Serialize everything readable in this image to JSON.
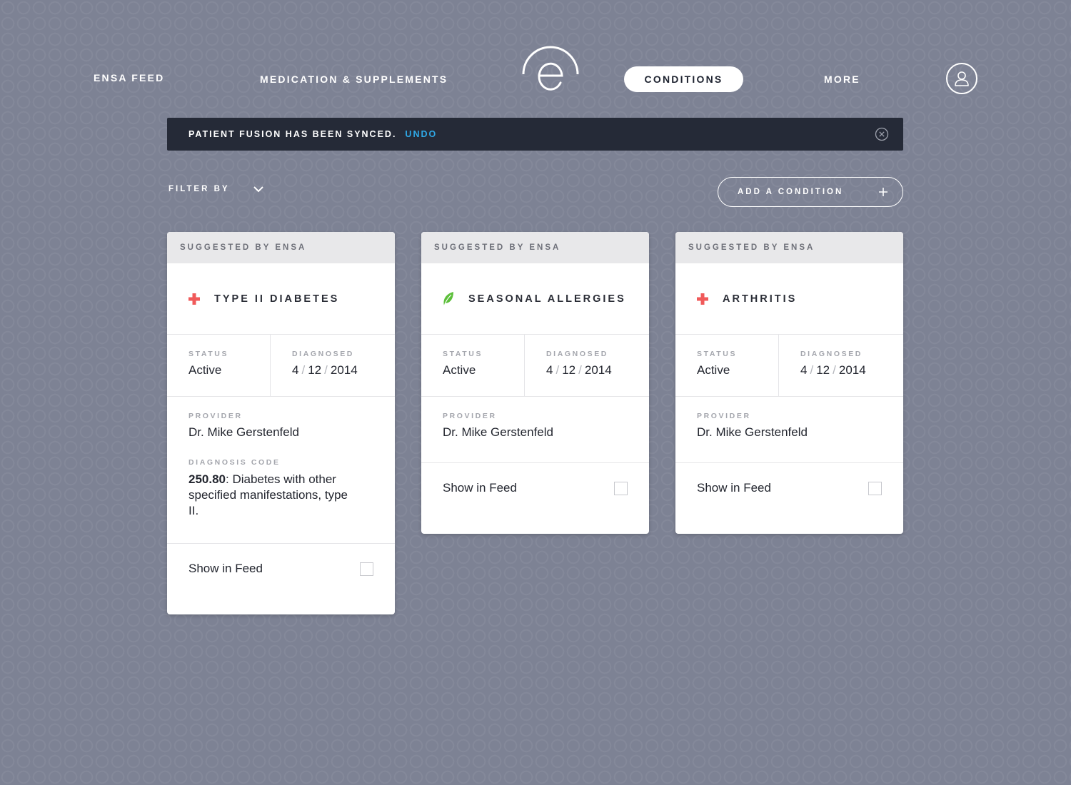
{
  "nav": {
    "items": [
      {
        "label": "ENSA FEED"
      },
      {
        "label": "MEDICATION & SUPPLEMENTS"
      },
      {
        "label": "CONDITIONS",
        "active": true
      },
      {
        "label": "MORE"
      }
    ],
    "logo_icon": "ensa-e-logo-icon",
    "avatar_icon": "user-icon"
  },
  "banner": {
    "message": "PATIENT FUSION HAS BEEN SYNCED.",
    "undo": "UNDO",
    "close_icon": "close-circle-icon"
  },
  "toolbar": {
    "filter_label": "FILTER BY",
    "add_label": "ADD A CONDITION"
  },
  "labels": {
    "status": "STATUS",
    "diagnosed": "DIAGNOSED",
    "provider": "PROVIDER",
    "diagnosis_code": "DIAGNOSIS CODE",
    "show_in_feed": "Show in Feed"
  },
  "colors": {
    "background": "#7d8294",
    "banner": "#252a37",
    "undo_link": "#2fa8e6",
    "cross_icon": "#f05a5a",
    "leaf_icon": "#5cbf3a"
  },
  "cards": [
    {
      "header": "SUGGESTED BY ENSA",
      "icon": "red-cross-icon",
      "title": "TYPE II DIABETES",
      "status": "Active",
      "diagnosed": {
        "month": "4",
        "day": "12",
        "year": "2014"
      },
      "provider": "Dr. Mike Gerstenfeld",
      "diagnosis_code": "250.80",
      "diagnosis_desc": ": Diabetes with other specified manifestations, type II.",
      "show_in_feed": false
    },
    {
      "header": "SUGGESTED BY ENSA",
      "icon": "leaf-icon",
      "title": "SEASONAL ALLERGIES",
      "status": "Active",
      "diagnosed": {
        "month": "4",
        "day": "12",
        "year": "2014"
      },
      "provider": "Dr. Mike Gerstenfeld",
      "show_in_feed": false
    },
    {
      "header": "SUGGESTED BY ENSA",
      "icon": "red-cross-icon",
      "title": "ARTHRITIS",
      "status": "Active",
      "diagnosed": {
        "month": "4",
        "day": "12",
        "year": "2014"
      },
      "provider": "Dr. Mike Gerstenfeld",
      "show_in_feed": false
    }
  ]
}
